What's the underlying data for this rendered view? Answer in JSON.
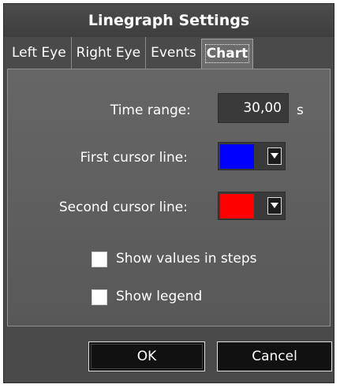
{
  "window": {
    "title": "Linegraph Settings"
  },
  "tabs": [
    {
      "label": "Left Eye",
      "active": false
    },
    {
      "label": "Right Eye",
      "active": false
    },
    {
      "label": "Events",
      "active": false
    },
    {
      "label": "Chart",
      "active": true
    }
  ],
  "chart_settings": {
    "time_range": {
      "label": "Time range:",
      "value": "30,00",
      "unit": "s"
    },
    "first_cursor": {
      "label": "First cursor line:",
      "color": "#0000ff"
    },
    "second_cursor": {
      "label": "Second cursor line:",
      "color": "#ff0000"
    },
    "show_values_in_steps": {
      "label": "Show values in steps",
      "checked": false
    },
    "show_legend": {
      "label": "Show legend",
      "checked": false
    }
  },
  "footer": {
    "ok_label": "OK",
    "cancel_label": "Cancel"
  },
  "icons": {
    "dropdown": "chevron-down-icon"
  }
}
